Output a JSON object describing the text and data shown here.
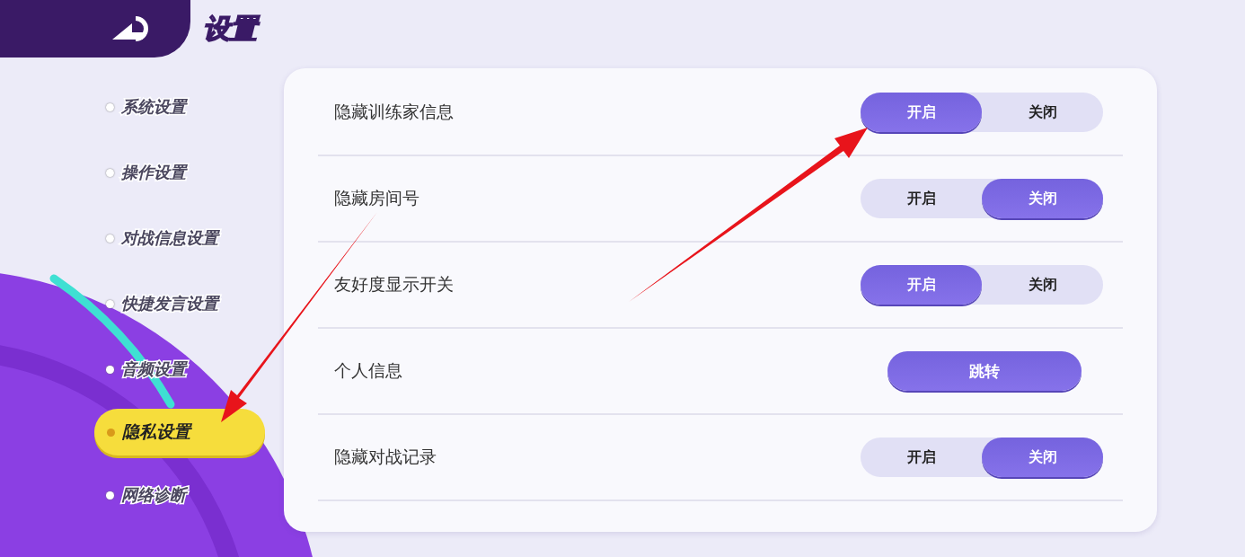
{
  "header": {
    "title": "设置"
  },
  "sidebar": {
    "items": [
      {
        "label": "系统设置",
        "selected": false
      },
      {
        "label": "操作设置",
        "selected": false
      },
      {
        "label": "对战信息设置",
        "selected": false
      },
      {
        "label": "快捷发言设置",
        "selected": false
      },
      {
        "label": "音频设置",
        "selected": false
      },
      {
        "label": "隐私设置",
        "selected": true
      },
      {
        "label": "网络诊断",
        "selected": false
      }
    ]
  },
  "settings": [
    {
      "label": "隐藏训练家信息",
      "kind": "toggle",
      "options": [
        {
          "label": "开启",
          "selected": true
        },
        {
          "label": "关闭",
          "selected": false
        }
      ]
    },
    {
      "label": "隐藏房间号",
      "kind": "toggle",
      "options": [
        {
          "label": "开启",
          "selected": false
        },
        {
          "label": "关闭",
          "selected": true
        }
      ]
    },
    {
      "label": "友好度显示开关",
      "kind": "toggle",
      "options": [
        {
          "label": "开启",
          "selected": true
        },
        {
          "label": "关闭",
          "selected": false
        }
      ]
    },
    {
      "label": "个人信息",
      "kind": "button",
      "button": "跳转"
    },
    {
      "label": "隐藏对战记录",
      "kind": "toggle",
      "options": [
        {
          "label": "开启",
          "selected": false
        },
        {
          "label": "关闭",
          "selected": true
        }
      ]
    }
  ]
}
